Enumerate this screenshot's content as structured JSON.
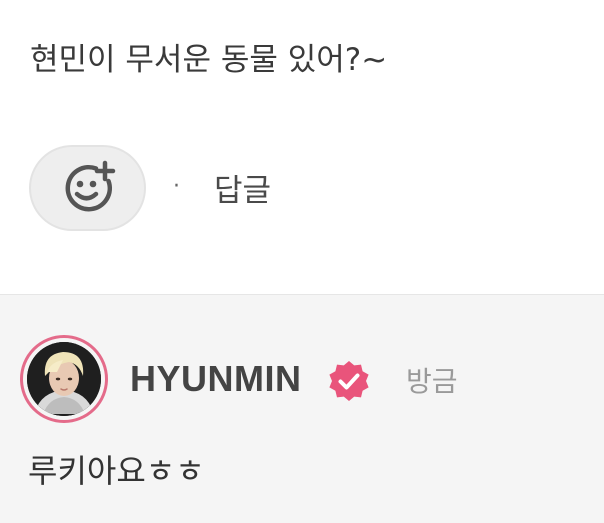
{
  "comment": {
    "text": "현민이 무서운 동물 있어?~",
    "separator": "·",
    "reply_label": "답글",
    "reaction_icon": "add-reaction-smiley-icon"
  },
  "reply": {
    "author": "HYUNMIN",
    "verified_icon": "verified-badge-icon",
    "timestamp": "방금",
    "text": "루키아요ㅎㅎ"
  },
  "colors": {
    "accent": "#e9547b",
    "avatar_ring": "#e46b8a",
    "reply_background": "#f5f5f5",
    "reaction_button_background": "#eeeeee"
  }
}
